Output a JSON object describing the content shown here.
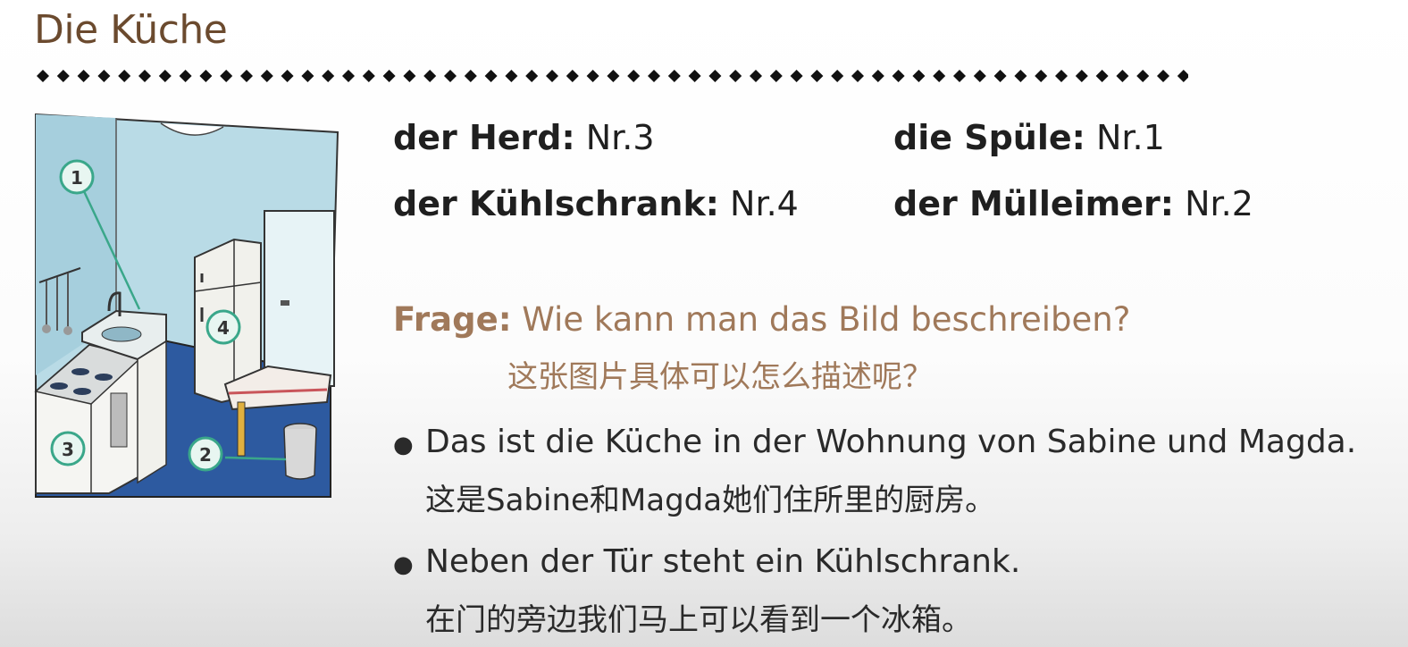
{
  "slide": {
    "title": "Die Küche"
  },
  "illustration": {
    "markers": [
      "1",
      "2",
      "3",
      "4"
    ],
    "colors": {
      "wall": "#b9dbe6",
      "floor": "#2d5aa0",
      "marker_stroke": "#3aa78a",
      "marker_fill": "#e8f6f1"
    }
  },
  "vocabulary": [
    {
      "term": "der Herd:",
      "number": "Nr.3"
    },
    {
      "term": "die Spüle:",
      "number": "Nr.1"
    },
    {
      "term": "der Kühlschrank:",
      "number": "Nr.4"
    },
    {
      "term": "der Mülleimer:",
      "number": "Nr.2"
    }
  ],
  "question": {
    "label": "Frage:",
    "text": "Wie kann man das Bild beschreiben?",
    "translation": "这张图片具体可以怎么描述呢？"
  },
  "statements": [
    {
      "bullet": "●",
      "de": "Das ist die Küche in der Wohnung von Sabine und Magda.",
      "zh": "这是Sabine和Magda她们住所里的厨房。"
    },
    {
      "bullet": "●",
      "de": "Neben der Tür steht ein Kühlschrank.",
      "zh": "在门的旁边我们马上可以看到一个冰箱。"
    }
  ],
  "colors": {
    "title": "#6b4a2e",
    "question": "#a0795a",
    "text": "#1f1f1f"
  }
}
